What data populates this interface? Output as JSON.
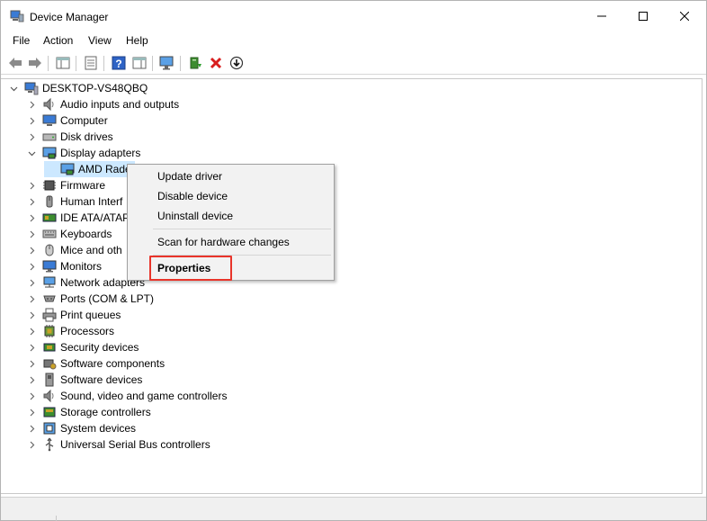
{
  "window": {
    "title": "Device Manager"
  },
  "menu": [
    "File",
    "Action",
    "View",
    "Help"
  ],
  "toolbar": {
    "buttons": [
      "back-arrow-icon",
      "forward-arrow-icon",
      "properties-view-icon",
      "properties-page-icon",
      "help-icon",
      "action-pane-icon",
      "scan-monitor-icon",
      "update-driver-icon",
      "uninstall-x-icon",
      "download-icon"
    ],
    "colors": {
      "uninstall": "#d81e1e",
      "help": "#2e63c6"
    }
  },
  "tree": {
    "root": "DESKTOP-VS48QBQ",
    "categories": [
      {
        "label": "Audio inputs and outputs",
        "icon": "speaker-icon",
        "expanded": false
      },
      {
        "label": "Computer",
        "icon": "computer-icon",
        "expanded": false
      },
      {
        "label": "Disk drives",
        "icon": "disk-drive-icon",
        "expanded": false
      },
      {
        "label": "Display adapters",
        "icon": "display-adapter-icon",
        "expanded": true,
        "children": [
          {
            "label": "AMD Rade",
            "icon": "display-adapter-icon",
            "selected": true
          }
        ]
      },
      {
        "label": "Firmware",
        "icon": "firmware-chip-icon",
        "expanded": false
      },
      {
        "label": "Human Interf",
        "icon": "hid-icon",
        "expanded": false
      },
      {
        "label": "IDE ATA/ATAP",
        "icon": "ide-controller-icon",
        "expanded": false
      },
      {
        "label": "Keyboards",
        "icon": "keyboard-icon",
        "expanded": false
      },
      {
        "label": "Mice and oth",
        "icon": "mouse-icon",
        "expanded": false
      },
      {
        "label": "Monitors",
        "icon": "monitor-icon",
        "expanded": false
      },
      {
        "label": "Network adapters",
        "icon": "network-icon",
        "expanded": false
      },
      {
        "label": "Ports (COM & LPT)",
        "icon": "port-icon",
        "expanded": false
      },
      {
        "label": "Print queues",
        "icon": "printer-icon",
        "expanded": false
      },
      {
        "label": "Processors",
        "icon": "processor-icon",
        "expanded": false
      },
      {
        "label": "Security devices",
        "icon": "security-icon",
        "expanded": false
      },
      {
        "label": "Software components",
        "icon": "software-component-icon",
        "expanded": false
      },
      {
        "label": "Software devices",
        "icon": "software-device-icon",
        "expanded": false
      },
      {
        "label": "Sound, video and game controllers",
        "icon": "sound-icon",
        "expanded": false
      },
      {
        "label": "Storage controllers",
        "icon": "storage-icon",
        "expanded": false
      },
      {
        "label": "System devices",
        "icon": "system-device-icon",
        "expanded": false
      },
      {
        "label": "Universal Serial Bus controllers",
        "icon": "usb-icon",
        "expanded": false
      }
    ]
  },
  "context_menu": {
    "items": [
      "Update driver",
      "Disable device",
      "Uninstall device",
      "Scan for hardware changes",
      "Properties"
    ],
    "highlighted": "Properties",
    "highlight_color": "#e8342a"
  },
  "colors": {
    "selection": "#cce8ff",
    "menu_bg": "#f2f2f2"
  }
}
